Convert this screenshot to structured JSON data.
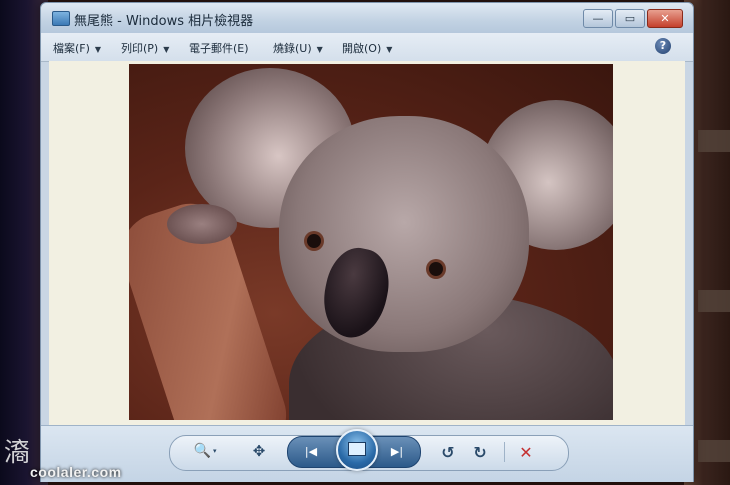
{
  "window": {
    "title": "無尾熊 - Windows 相片檢視器",
    "minimize_icon": "minimize-icon",
    "maximize_icon": "maximize-icon",
    "close_icon": "close-icon",
    "min_glyph": "—",
    "max_glyph": "▭",
    "close_glyph": "✕"
  },
  "menu": {
    "items": [
      {
        "label": "檔案(F)"
      },
      {
        "label": "列印(P)"
      },
      {
        "label": "電子郵件(E)"
      },
      {
        "label": "燒錄(U)"
      },
      {
        "label": "開啟(O)"
      }
    ],
    "dropdown_glyph": "▼",
    "help_glyph": "?"
  },
  "viewer": {
    "image_subject": "koala",
    "background_color": "#f2f0e2"
  },
  "controls": {
    "zoom_glyph": "🔍",
    "zoom_dropdown_glyph": "▾",
    "fit_glyph": "✥",
    "prev_glyph": "|◀",
    "next_glyph": "▶|",
    "rotate_left_glyph": "↺",
    "rotate_right_glyph": "↻",
    "delete_glyph": "✕"
  },
  "watermark": {
    "text": "coolaler.com",
    "mark": "㵝"
  }
}
